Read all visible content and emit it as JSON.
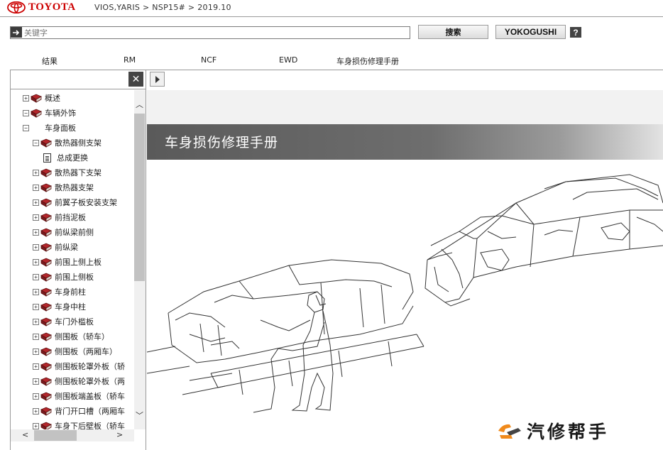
{
  "header": {
    "brand": "TOYOTA",
    "breadcrumb": "VIOS,YARIS > NSP15# > 2019.10"
  },
  "search": {
    "placeholder": "关键字",
    "search_label": "搜索",
    "yokogushi_label": "YOKOGUSHI",
    "help_label": "?"
  },
  "tabs": [
    "结果",
    "RM",
    "NCF",
    "EWD",
    "车身损伤修理手册"
  ],
  "tree": [
    {
      "label": "概述",
      "level": 0,
      "toggle": "+",
      "icon": "book-icon"
    },
    {
      "label": "车辆外饰",
      "level": 0,
      "toggle": "−",
      "icon": "book-icon"
    },
    {
      "label": "车身面板",
      "level": 1,
      "toggle": "−",
      "icon": "none"
    },
    {
      "label": "散热器侧支架",
      "level": 2,
      "toggle": "−",
      "icon": "book-icon"
    },
    {
      "label": "总成更换",
      "level": 3,
      "toggle": "",
      "icon": "doc-icon"
    },
    {
      "label": "散热器下支架",
      "level": 2,
      "toggle": "+",
      "icon": "book-icon"
    },
    {
      "label": "散热器支架",
      "level": 2,
      "toggle": "+",
      "icon": "book-icon"
    },
    {
      "label": "前翼子板安装支架",
      "level": 2,
      "toggle": "+",
      "icon": "book-icon"
    },
    {
      "label": "前挡泥板",
      "level": 2,
      "toggle": "+",
      "icon": "book-icon"
    },
    {
      "label": "前纵梁前侧",
      "level": 2,
      "toggle": "+",
      "icon": "book-icon"
    },
    {
      "label": "前纵梁",
      "level": 2,
      "toggle": "+",
      "icon": "book-icon"
    },
    {
      "label": "前围上侧上板",
      "level": 2,
      "toggle": "+",
      "icon": "book-icon"
    },
    {
      "label": "前围上侧板",
      "level": 2,
      "toggle": "+",
      "icon": "book-icon"
    },
    {
      "label": "车身前柱",
      "level": 2,
      "toggle": "+",
      "icon": "book-icon"
    },
    {
      "label": "车身中柱",
      "level": 2,
      "toggle": "+",
      "icon": "book-icon"
    },
    {
      "label": "车门外槛板",
      "level": 2,
      "toggle": "+",
      "icon": "book-icon"
    },
    {
      "label": "侧围板（轿车）",
      "level": 2,
      "toggle": "+",
      "icon": "book-icon"
    },
    {
      "label": "侧围板（两厢车）",
      "level": 2,
      "toggle": "+",
      "icon": "book-icon"
    },
    {
      "label": "侧围板轮罩外板（轿",
      "level": 2,
      "toggle": "+",
      "icon": "book-icon"
    },
    {
      "label": "侧围板轮罩外板（两",
      "level": 2,
      "toggle": "+",
      "icon": "book-icon"
    },
    {
      "label": "侧围板端盖板（轿车",
      "level": 2,
      "toggle": "+",
      "icon": "book-icon"
    },
    {
      "label": "背门开口槽（两厢车",
      "level": 2,
      "toggle": "+",
      "icon": "book-icon"
    },
    {
      "label": "车身下后壁板（轿车",
      "level": 2,
      "toggle": "+",
      "icon": "book-icon"
    }
  ],
  "content": {
    "title": "车身损伤修理手册"
  },
  "watermark": {
    "text": "汽修帮手"
  },
  "colors": {
    "brand_red": "#cc0000",
    "book_red": "#b3262b",
    "banner_dark": "#5a5a5a"
  }
}
